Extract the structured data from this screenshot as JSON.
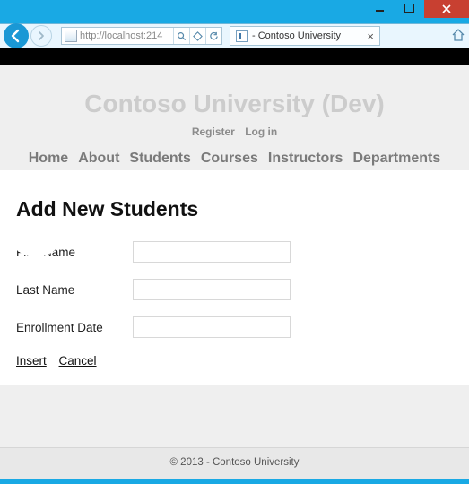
{
  "browser": {
    "url": "http://localhost:214",
    "tab_title": " - Contoso University"
  },
  "site": {
    "title": "Contoso University (Dev)",
    "auth": {
      "register": "Register",
      "login": "Log in"
    },
    "nav": {
      "home": "Home",
      "about": "About",
      "students": "Students",
      "courses": "Courses",
      "instructors": "Instructors",
      "departments": "Departments"
    }
  },
  "page": {
    "heading": "Add New Students",
    "fields": {
      "first_name": {
        "label": "First Name",
        "value": ""
      },
      "last_name": {
        "label": "Last Name",
        "value": ""
      },
      "enrollment_date": {
        "label": "Enrollment Date",
        "value": ""
      }
    },
    "actions": {
      "insert": "Insert",
      "cancel": "Cancel"
    }
  },
  "footer": {
    "text": "© 2013 - Contoso University"
  }
}
